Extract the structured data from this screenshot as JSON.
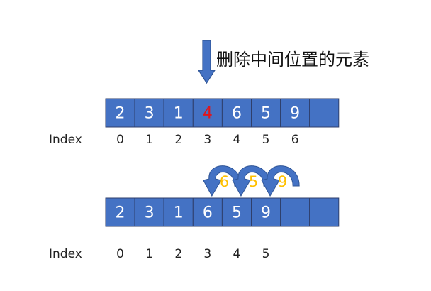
{
  "title": "删除中间位置的元素",
  "colors": {
    "cell_fill": "#4472c4",
    "cell_border": "#2f3f6b",
    "arrow_fill": "#4472c4",
    "arrow_border": "#2f5597",
    "highlight_text": "#e0151c",
    "moving_text": "#ffc000"
  },
  "before": {
    "cells": [
      "2",
      "3",
      "1",
      "4",
      "6",
      "5",
      "9",
      ""
    ],
    "highlight_index": 3,
    "index_label": "Index",
    "indices": [
      "0",
      "1",
      "2",
      "3",
      "4",
      "5",
      "6"
    ]
  },
  "after": {
    "cells": [
      "2",
      "3",
      "1",
      "6",
      "5",
      "9",
      "",
      ""
    ],
    "index_label": "Index",
    "indices": [
      "0",
      "1",
      "2",
      "3",
      "4",
      "5"
    ]
  },
  "shift_arrows": [
    {
      "value": "6",
      "from_slot": 4,
      "to_slot": 3
    },
    {
      "value": "5",
      "from_slot": 5,
      "to_slot": 4
    },
    {
      "value": "9",
      "from_slot": 6,
      "to_slot": 5
    }
  ]
}
